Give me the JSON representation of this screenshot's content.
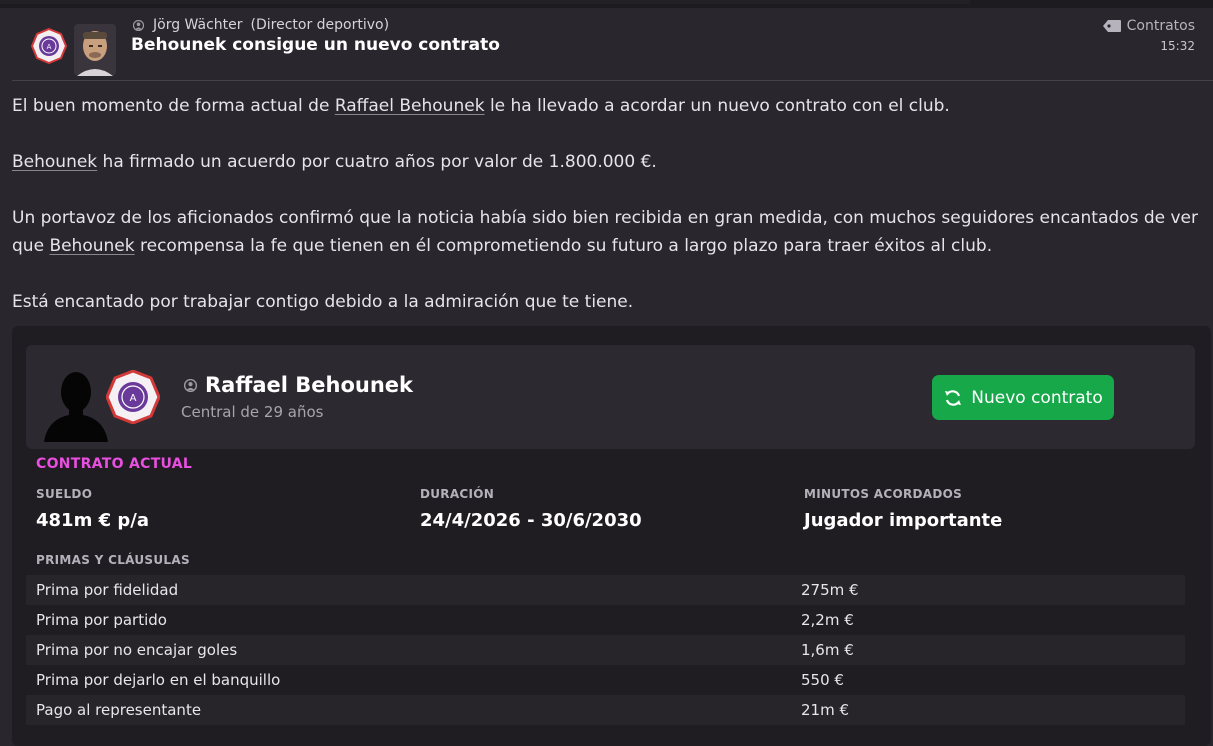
{
  "header": {
    "sender_name": "Jörg Wächter",
    "sender_role": "(Director deportivo)",
    "title": "Behounek consigue un nuevo contrato",
    "category": "Contratos",
    "time": "15:32"
  },
  "body": {
    "p1_pre": "El buen momento de forma actual de ",
    "p1_link": "Raffael Behounek",
    "p1_post": " le ha llevado a acordar un nuevo contrato con el club.",
    "p2_link": "Behounek",
    "p2_post": " ha firmado un acuerdo por cuatro años por valor de 1.800.000 €.",
    "p3_pre": "Un portavoz de los aficionados confirmó que la noticia había sido bien recibida en gran medida, con muchos seguidores encantados de ver que ",
    "p3_link": "Behounek",
    "p3_post": " recompensa la fe que tienen en él comprometiendo su futuro a largo plazo para traer éxitos al club.",
    "p4": "Está encantado por trabajar contigo debido a la admiración que te tiene."
  },
  "player": {
    "name": "Raffael Behounek",
    "subtitle": "Central de 29 años",
    "button_label": "Nuevo contrato"
  },
  "contract": {
    "section_title": "CONTRATO ACTUAL",
    "salary_label": "SUELDO",
    "salary_value": "481m € p/a",
    "duration_label": "DURACIÓN",
    "duration_value": "24/4/2026 - 30/6/2030",
    "minutes_label": "MINUTOS ACORDADOS",
    "minutes_value": "Jugador importante",
    "bonuses_title": "PRIMAS Y CLÁUSULAS",
    "bonuses": [
      {
        "name": "Prima por fidelidad",
        "value": "275m €"
      },
      {
        "name": "Prima por partido",
        "value": "2,2m €"
      },
      {
        "name": "Prima por no encajar goles",
        "value": "1,6m €"
      },
      {
        "name": "Prima por dejarlo en el banquillo",
        "value": "550 €"
      },
      {
        "name": "Pago al representante",
        "value": "21m €"
      }
    ]
  },
  "colors": {
    "accent_pink": "#e94fe0",
    "button_green": "#17a84a",
    "background": "#2a262d"
  }
}
